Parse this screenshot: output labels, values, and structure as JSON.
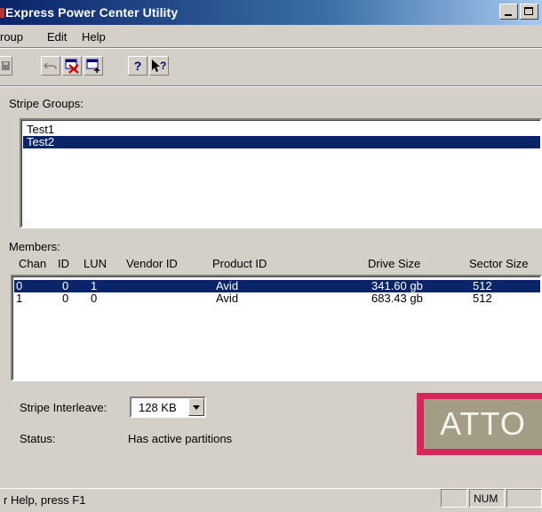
{
  "window": {
    "title": "Express Power Center Utility"
  },
  "menu": {
    "items": [
      "roup",
      "Edit",
      "Help"
    ]
  },
  "toolbar": {
    "help_label": "?",
    "context_help_label": "?"
  },
  "stripe_groups": {
    "label": "Stripe Groups:",
    "items": [
      {
        "name": "Test1",
        "selected": false
      },
      {
        "name": "Test2",
        "selected": true
      }
    ]
  },
  "members": {
    "label": "Members:",
    "columns": [
      "Chan",
      "ID",
      "LUN",
      "Vendor ID",
      "Product ID",
      "Drive Size",
      "Sector Size"
    ],
    "rows": [
      {
        "chan": "0",
        "id": "0",
        "lun": "1",
        "vendor": "",
        "product": "Avid",
        "size": "341.60 gb",
        "sector": "512",
        "selected": true
      },
      {
        "chan": "1",
        "id": "0",
        "lun": "0",
        "vendor": "",
        "product": "Avid",
        "size": "683.43 gb",
        "sector": "512",
        "selected": false
      }
    ]
  },
  "interleave": {
    "label": "Stripe Interleave:",
    "value": "128 KB"
  },
  "status": {
    "label": "Status:",
    "value": "Has active partitions"
  },
  "logo": {
    "text": "ATTO"
  },
  "statusbar": {
    "text": "r Help, press F1",
    "num": "NUM"
  },
  "colors": {
    "selection": "#0a246a",
    "logo_frame": "#d8265a",
    "logo_bg": "#a29d84",
    "face": "#d4d0c8"
  }
}
